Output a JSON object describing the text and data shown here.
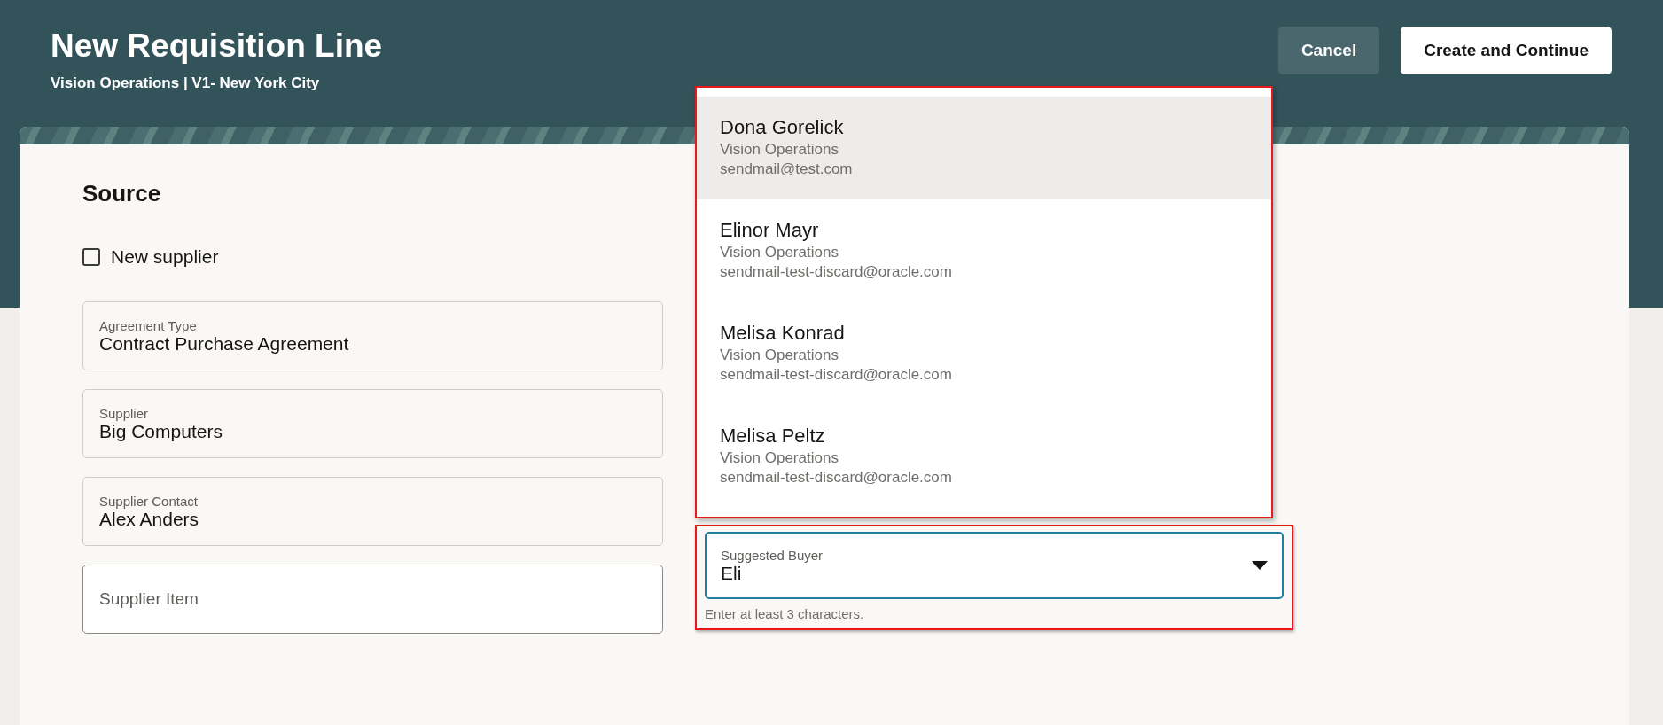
{
  "header": {
    "title": "New Requisition Line",
    "subtitle": "Vision Operations | V1- New York City",
    "buttons": [
      {
        "label": "Cancel",
        "kind": "secondary"
      },
      {
        "label": "Create and Continue",
        "kind": "primary"
      }
    ]
  },
  "section": {
    "title": "Source"
  },
  "new_supplier": {
    "label": "New supplier",
    "checked": false
  },
  "fields": [
    {
      "label": "Agreement Type",
      "value": "Contract Purchase Agreement",
      "kind": "readonly"
    },
    {
      "label": "Supplier",
      "value": "Big Computers",
      "kind": "readonly"
    },
    {
      "label": "Supplier Contact",
      "value": "Alex Anders",
      "kind": "readonly"
    },
    {
      "label": "Supplier Item",
      "kind": "input"
    }
  ],
  "suggested_buyer": {
    "label": "Suggested Buyer",
    "value": "Eli",
    "helper": "Enter at least 3 characters.",
    "expanded": true
  },
  "buyer_options": [
    {
      "name": "Dona Gorelick",
      "organization": "Vision Operations",
      "email": "sendmail@test.com",
      "selected": true
    },
    {
      "name": "Elinor Mayr",
      "organization": "Vision Operations",
      "email": "sendmail-test-discard@oracle.com",
      "selected": false
    },
    {
      "name": "Melisa Konrad",
      "organization": "Vision Operations",
      "email": "sendmail-test-discard@oracle.com",
      "selected": false
    },
    {
      "name": "Melisa Peltz",
      "organization": "Vision Operations",
      "email": "sendmail-test-discard@oracle.com",
      "selected": false
    }
  ]
}
